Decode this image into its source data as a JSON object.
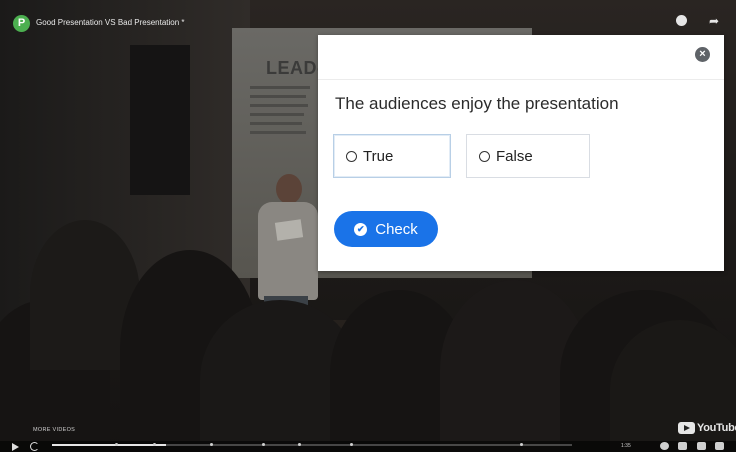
{
  "video": {
    "channel_initial": "P",
    "title": "Good Presentation VS Bad Presentation *",
    "slide_heading": "LEAD-L",
    "more_videos": "MORE VIDEOS",
    "brand": "YouTube",
    "time": "1:35"
  },
  "quiz": {
    "question": "The audiences enjoy the presentation",
    "options": [
      {
        "label": "True",
        "selected": true
      },
      {
        "label": "False",
        "selected": false
      }
    ],
    "check_label": "Check",
    "close_symbol": "×"
  },
  "icons": {
    "channel": "channel-avatar-icon",
    "watch_later": "clock-icon",
    "share": "share-icon",
    "close": "close-icon",
    "check": "check-circle-icon",
    "play": "play-icon",
    "replay": "replay-icon"
  },
  "colors": {
    "accent": "#1a73e8",
    "avatar": "#4caf50",
    "overlay_bg": "#ffffff"
  }
}
